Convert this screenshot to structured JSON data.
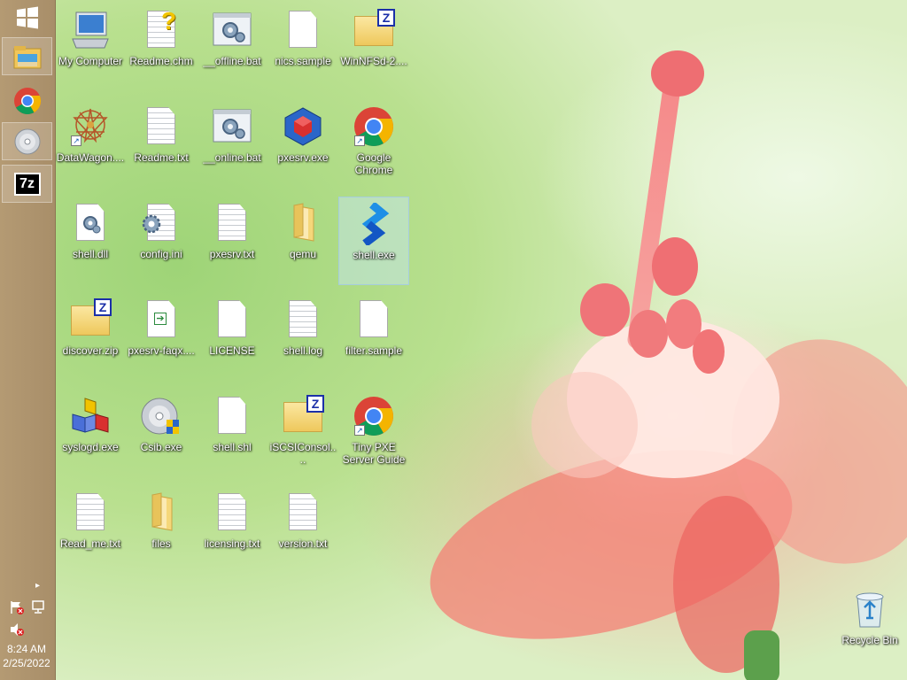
{
  "taskbar": {
    "start_label": "Start",
    "items": [
      {
        "name": "file-explorer",
        "active": true
      },
      {
        "name": "google-chrome",
        "active": false
      },
      {
        "name": "disc-app",
        "active": true
      },
      {
        "name": "7-zip",
        "label": "7z",
        "active": true
      }
    ],
    "clock": {
      "time": "8:24 AM",
      "date": "2/25/2022"
    }
  },
  "desktop_icons": [
    {
      "label": "My Computer",
      "type": "computer"
    },
    {
      "label": "Readme.chm",
      "type": "help"
    },
    {
      "label": "__offline.bat",
      "type": "batch"
    },
    {
      "label": "nics.sample",
      "type": "blank"
    },
    {
      "label": "WinNFSd-2....",
      "type": "zip"
    },
    {
      "label": "DataWagon....",
      "type": "datawagon"
    },
    {
      "label": "Readme.txt",
      "type": "text"
    },
    {
      "label": "__online.bat",
      "type": "batch"
    },
    {
      "label": "pxesrv.exe",
      "type": "pxesrv"
    },
    {
      "label": "Google Chrome",
      "type": "chrome-shortcut"
    },
    {
      "label": "shell.dll",
      "type": "dll"
    },
    {
      "label": "config.ini",
      "type": "ini"
    },
    {
      "label": "pxesrv.txt",
      "type": "text"
    },
    {
      "label": "qemu",
      "type": "folder"
    },
    {
      "label": "shell.exe",
      "type": "shell-exe",
      "selected": true
    },
    {
      "label": "discover.zip",
      "type": "zip"
    },
    {
      "label": "pxesrv-faqx....",
      "type": "html-doc"
    },
    {
      "label": "LICENSE",
      "type": "blank"
    },
    {
      "label": "shell.log",
      "type": "text"
    },
    {
      "label": "filter.sample",
      "type": "blank"
    },
    {
      "label": "syslogd.exe",
      "type": "syslogd"
    },
    {
      "label": "Csib.exe",
      "type": "disc-setup"
    },
    {
      "label": "shell.shl",
      "type": "blank"
    },
    {
      "label": "iSCSIConsol....",
      "type": "zip"
    },
    {
      "label": "Tiny PXE Server Guide",
      "type": "chrome-shortcut"
    },
    {
      "label": "Read_me.txt",
      "type": "text"
    },
    {
      "label": "files",
      "type": "folder"
    },
    {
      "label": "licensing.txt",
      "type": "text"
    },
    {
      "label": "version.txt",
      "type": "text"
    },
    {
      "label": "Recycle Bin",
      "type": "recycle"
    }
  ]
}
